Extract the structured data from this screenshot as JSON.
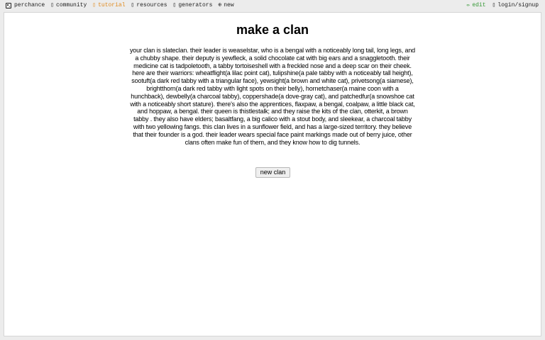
{
  "nav": {
    "left": [
      {
        "label": "perchance",
        "icon": "dice-icon"
      },
      {
        "label": "community",
        "icon": "community-icon"
      },
      {
        "label": "tutorial",
        "icon": "tutorial-icon"
      },
      {
        "label": "resources",
        "icon": "resources-icon"
      },
      {
        "label": "generators",
        "icon": "generators-icon"
      },
      {
        "label": "new",
        "icon": "plus-circle-icon"
      }
    ],
    "right": [
      {
        "label": "edit",
        "icon": "pencil-icon"
      },
      {
        "label": "login/signup",
        "icon": "user-icon"
      }
    ]
  },
  "colors": {
    "tutorial": "#e08a1e",
    "edit": "#3a9a3a",
    "background": "#ececec",
    "panel": "#ffffff"
  },
  "main": {
    "title": "make a clan",
    "story": "your clan is slateclan. their leader is weaselstar, who is a bengal with a noticeably long tail, long legs, and a chubby shape. their deputy is yewfleck, a solid chocolate cat with big ears and a snaggletooth. their medicine cat is tadpoletooth, a tabby tortoiseshell with a freckled nose and a deep scar on their cheek. here are their warriors: wheatflight(a lilac point cat), tulipshine(a pale tabby with a noticeably tall height), sootuft(a dark red tabby with a triangular face), yewsight(a brown and white cat), privetsong(a siamese), brightthorn(a dark red tabby with light spots on their belly), hornetchaser(a maine coon with a hunchback), dewbelly(a charcoal tabby), coppershade(a dove-gray cat), and patchedfur(a snowshoe cat with a noticeably short stature). there's also the apprentices, flaxpaw, a bengal, coalpaw, a little black cat, and hoppaw, a bengal. their queen is thistlestalk; and they raise the kits of the clan, otterkit, a brown tabby . they also have elders; basaltfang, a big calico with a stout body, and sleekear, a charcoal tabby with two yellowing fangs. this clan lives in a sunflower field, and has a large-sized territory. they believe that their founder is a god. their leader wears special face paint markings made out of berry juice, other clans often make fun of them, and they know how to dig tunnels.",
    "button_label": "new clan"
  }
}
